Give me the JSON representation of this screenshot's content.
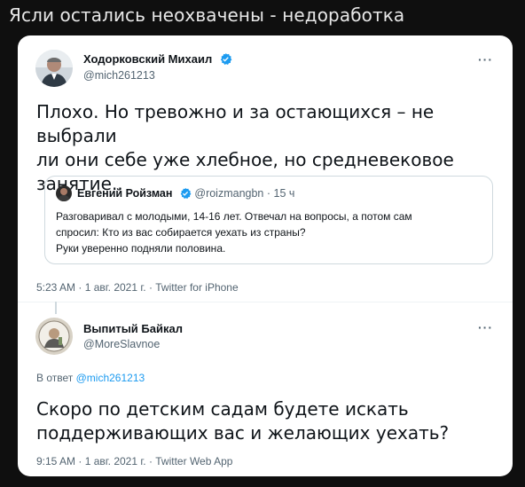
{
  "caption": "Ясли остались неохвачены - недоработка",
  "tweet1": {
    "name": "Ходорковский Михаил",
    "handle": "@mich261213",
    "more": "···",
    "text_lines": [
      "Плохо. Но тревожно и за остающихся – не выбрали",
      "ли они себе уже хлебное, но средневековое",
      "занятие.."
    ],
    "meta": "5:23 AM · 1 авг. 2021 г. · Twitter for iPhone",
    "quote": {
      "name": "Евгений Ройзман",
      "handle": "@roizmangbn",
      "time": "· 15 ч",
      "text_lines": [
        "Разговаривал с молодыми, 14-16 лет. Отвечал на вопросы, а потом сам",
        "спросил: Кто из вас собирается уехать из страны?",
        "Руки уверенно подняли половина."
      ]
    }
  },
  "tweet2": {
    "name": "Выпитый Байкал",
    "handle": "@MoreSlavnoe",
    "more": "···",
    "reply_prefix": "В ответ",
    "reply_handle": "@mich261213",
    "text_lines": [
      "Скоро по детским садам будете искать",
      "поддерживающих вас и желающих уехать?"
    ],
    "meta": "9:15 AM · 1 авг. 2021 г. · Twitter Web App"
  },
  "colors": {
    "verified": "#1d9bf0",
    "link": "#1d9bf0",
    "secondary_text": "#536471"
  }
}
